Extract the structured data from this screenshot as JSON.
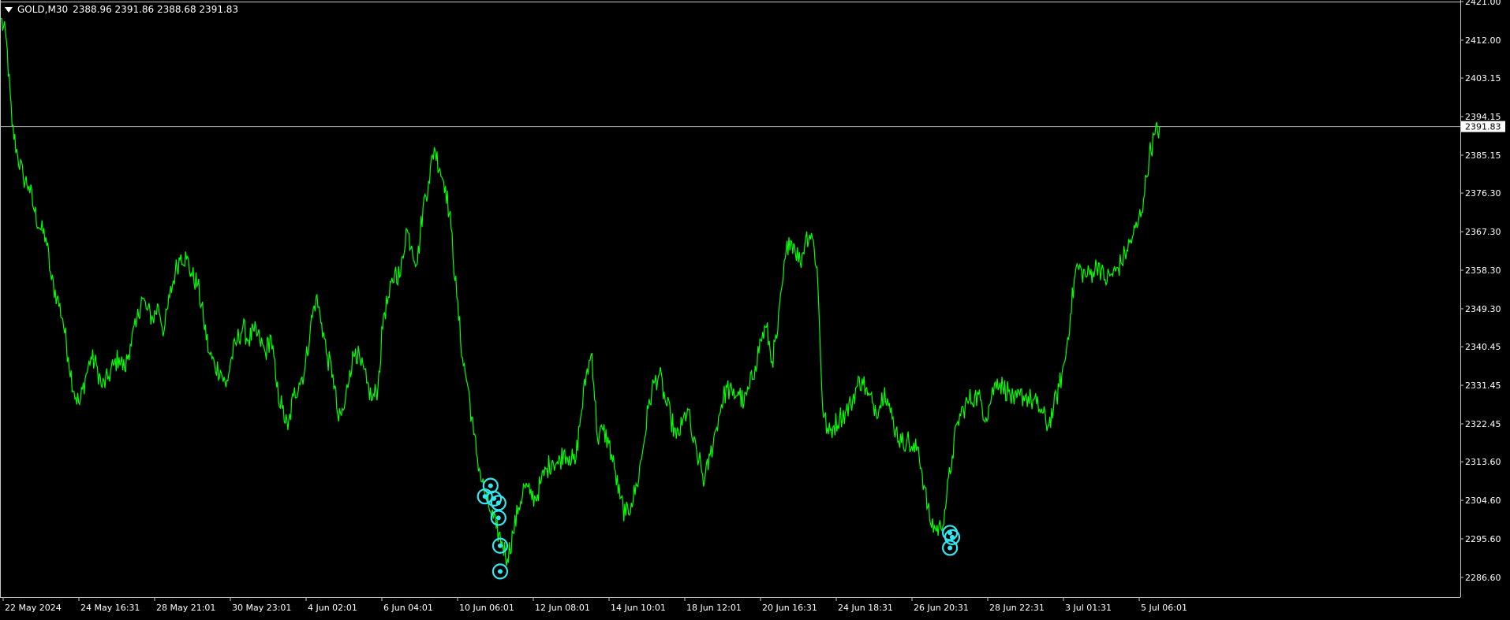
{
  "header": {
    "symbol_timeframe": "GOLD,M30",
    "ohlc": "2388.96 2391.86 2388.68 2391.83"
  },
  "colors": {
    "background": "#000000",
    "price_line": "#00ff00",
    "markers": "#33e6f0",
    "axis_text": "#ffffff",
    "frame": "#c8c8c8",
    "bid_line": "#b4b4b4"
  },
  "icons": {
    "dropdown": "triangle-down-icon"
  },
  "chart_data": {
    "type": "line",
    "title": "",
    "xlabel": "",
    "ylabel": "",
    "ylim": [
      2282.0,
      2421.0
    ],
    "y_ticks": [
      "2421.00",
      "2412.00",
      "2403.15",
      "2394.15",
      "2385.15",
      "2376.30",
      "2367.30",
      "2358.30",
      "2349.30",
      "2340.45",
      "2331.45",
      "2322.45",
      "2313.60",
      "2304.60",
      "2295.60",
      "2286.60"
    ],
    "x_ticks": [
      "22 May 2024",
      "24 May 16:31",
      "28 May 21:01",
      "30 May 23:01",
      "4 Jun 02:01",
      "6 Jun 04:01",
      "10 Jun 06:01",
      "12 Jun 08:01",
      "14 Jun 10:01",
      "18 Jun 12:01",
      "20 Jun 16:31",
      "24 Jun 18:31",
      "26 Jun 20:31",
      "28 Jun 22:31",
      "3 Jul 01:31",
      "5 Jul 06:01"
    ],
    "current_price_label": "2391.83",
    "current_price": 2391.83,
    "grid": false,
    "series": [
      {
        "values": [
          2417,
          2412,
          2392,
          2385,
          2380,
          2378,
          2372,
          2368,
          2366,
          2356,
          2352,
          2347,
          2338,
          2330,
          2327,
          2333,
          2338,
          2336,
          2331,
          2333,
          2336,
          2338,
          2335,
          2341,
          2345,
          2352,
          2349,
          2347,
          2350,
          2344,
          2352,
          2358,
          2362,
          2361,
          2357,
          2355,
          2347,
          2339,
          2336,
          2335,
          2331,
          2338,
          2342,
          2345,
          2342,
          2344,
          2342,
          2339,
          2343,
          2331,
          2326,
          2321,
          2329,
          2332,
          2335,
          2345,
          2352,
          2346,
          2338,
          2334,
          2323,
          2326,
          2335,
          2340,
          2336,
          2332,
          2328,
          2331,
          2348,
          2352,
          2358,
          2357,
          2368,
          2364,
          2360,
          2373,
          2379,
          2387,
          2382,
          2378,
          2368,
          2352,
          2338,
          2331,
          2320,
          2312,
          2306,
          2302,
          2298,
          2295,
          2291,
          2297,
          2303,
          2308,
          2306,
          2305,
          2309,
          2312,
          2314,
          2313,
          2316,
          2315,
          2313,
          2324,
          2334,
          2339,
          2319,
          2321,
          2318,
          2312,
          2305,
          2301,
          2304,
          2308,
          2316,
          2326,
          2332,
          2334,
          2328,
          2324,
          2319,
          2322,
          2326,
          2318,
          2314,
          2309,
          2315,
          2321,
          2327,
          2331,
          2329,
          2330,
          2327,
          2331,
          2336,
          2342,
          2345,
          2337,
          2344,
          2357,
          2366,
          2364,
          2360,
          2366,
          2367,
          2359,
          2326,
          2320,
          2322,
          2324,
          2325,
          2327,
          2331,
          2333,
          2329,
          2327,
          2326,
          2331,
          2325,
          2321,
          2318,
          2319,
          2316,
          2317,
          2308,
          2300,
          2298,
          2298,
          2305,
          2315,
          2323,
          2326,
          2328,
          2329,
          2328,
          2324,
          2329,
          2333,
          2331,
          2330,
          2327,
          2329,
          2329,
          2328,
          2327,
          2325,
          2322,
          2326,
          2331,
          2337,
          2348,
          2359,
          2358,
          2357,
          2358,
          2360,
          2356,
          2357,
          2358,
          2360,
          2363,
          2366,
          2369,
          2375,
          2385,
          2390,
          2391.83
        ]
      }
    ],
    "markers": [
      {
        "x_index": 87,
        "y": 2308.0
      },
      {
        "x_index": 86,
        "y": 2305.5
      },
      {
        "x_index": 87.6,
        "y": 2305.0
      },
      {
        "x_index": 88.4,
        "y": 2304.0
      },
      {
        "x_index": 88.4,
        "y": 2300.5
      },
      {
        "x_index": 88.7,
        "y": 2294.0
      },
      {
        "x_index": 88.7,
        "y": 2288.0
      },
      {
        "x_index": 168.6,
        "y": 2297.0
      },
      {
        "x_index": 169.0,
        "y": 2296.0
      },
      {
        "x_index": 168.6,
        "y": 2293.5
      }
    ]
  }
}
